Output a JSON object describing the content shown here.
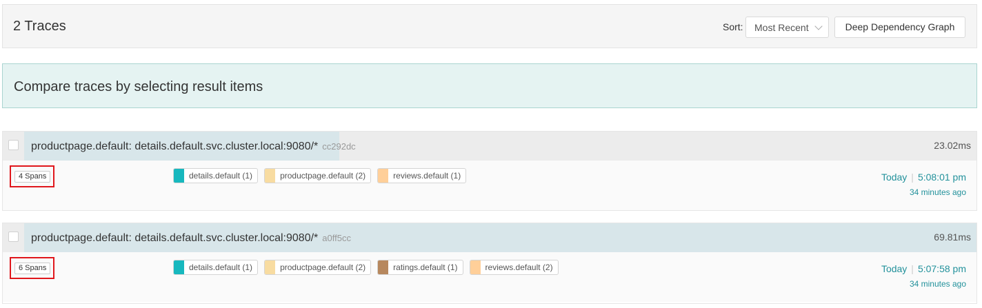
{
  "header": {
    "title": "2 Traces",
    "sort_label": "Sort:",
    "sort_value": "Most Recent",
    "dep_graph_label": "Deep Dependency Graph"
  },
  "compare_banner": "Compare traces by selecting result items",
  "traces": [
    {
      "name": "productpage.default: details.default.svc.cluster.local:9080/*",
      "trace_id": "cc292dc",
      "duration": "23.02ms",
      "spans": "4 Spans",
      "services": [
        {
          "label": "details.default (1)",
          "color": "#17b8be"
        },
        {
          "label": "productpage.default (2)",
          "color": "#f8dca1"
        },
        {
          "label": "reviews.default (1)",
          "color": "#ffcf99"
        }
      ],
      "day": "Today",
      "time": "5:08:01 pm",
      "ago": "34 minutes ago"
    },
    {
      "name": "productpage.default: details.default.svc.cluster.local:9080/*",
      "trace_id": "a0ff5cc",
      "duration": "69.81ms",
      "spans": "6 Spans",
      "services": [
        {
          "label": "details.default (1)",
          "color": "#17b8be"
        },
        {
          "label": "productpage.default (2)",
          "color": "#f8dca1"
        },
        {
          "label": "ratings.default (1)",
          "color": "#b7885e"
        },
        {
          "label": "reviews.default (2)",
          "color": "#ffcf99"
        }
      ],
      "day": "Today",
      "time": "5:07:58 pm",
      "ago": "34 minutes ago"
    }
  ],
  "colors": {
    "accent": "#22919b",
    "highlight_box": "#e0161b",
    "banner_bg": "#e5f3f2"
  }
}
